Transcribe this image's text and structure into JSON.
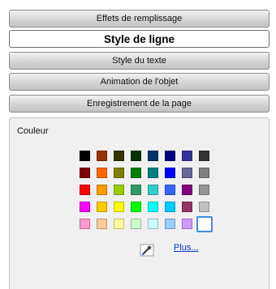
{
  "tabs": [
    {
      "label": "Effets de remplissage"
    },
    {
      "label": "Style de ligne",
      "active": true
    },
    {
      "label": "Style du texte"
    },
    {
      "label": "Animation de l'objet"
    },
    {
      "label": "Enregistrement de la page"
    }
  ],
  "panel": {
    "label": "Couleur",
    "more_link": "Plus...",
    "picker_icon": "eyedropper-icon",
    "selected_color": "#ffffff",
    "palette": [
      [
        "#000000",
        "#993300",
        "#333300",
        "#003300",
        "#003366",
        "#000080",
        "#333399",
        "#333333"
      ],
      [
        "#800000",
        "#ff6600",
        "#808000",
        "#008000",
        "#008080",
        "#0000ff",
        "#666699",
        "#808080"
      ],
      [
        "#ff0000",
        "#ff9900",
        "#99cc00",
        "#339966",
        "#33cccc",
        "#3366ff",
        "#800080",
        "#969696"
      ],
      [
        "#ff00ff",
        "#ffcc00",
        "#ffff00",
        "#00ff00",
        "#00ffff",
        "#00ccff",
        "#993366",
        "#c0c0c0"
      ],
      [
        "#ff99cc",
        "#ffcc99",
        "#ffff99",
        "#ccffcc",
        "#ccffff",
        "#99ccff",
        "#cc99ff",
        "#ffffff"
      ]
    ]
  }
}
